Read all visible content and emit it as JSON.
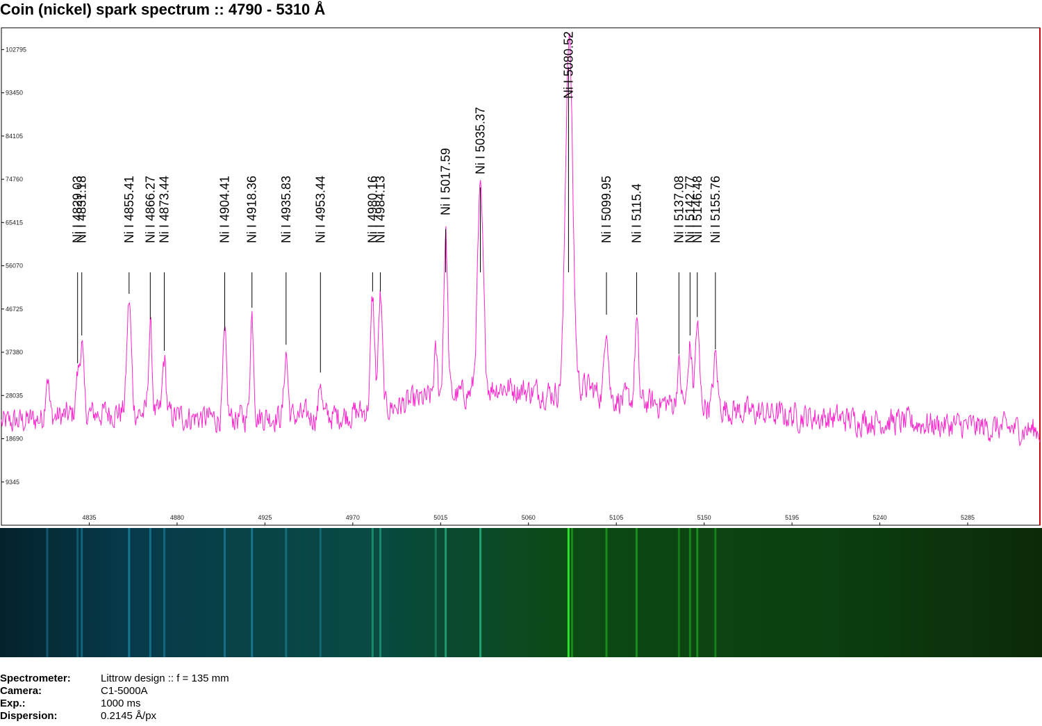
{
  "title": "Coin (nickel) spark spectrum :: 4790 - 5310 Å",
  "colors": {
    "spectrum": "#ff22cc",
    "frame": "#000000",
    "frame_right": "#cc0000",
    "strip_blue": "#063a4a",
    "strip_green": "#0c4a14"
  },
  "chart_data": {
    "type": "line",
    "title": "Coin (nickel) spark spectrum :: 4790 - 5310 Å",
    "xlabel": "",
    "ylabel": "",
    "xlim": [
      4790,
      5322
    ],
    "ylim": [
      0,
      107500
    ],
    "x_ticks": [
      4835,
      4880,
      4925,
      4970,
      5015,
      5060,
      5105,
      5150,
      5195,
      5240,
      5285
    ],
    "y_ticks": [
      9345,
      18690,
      28035,
      37380,
      46725,
      56070,
      65415,
      74760,
      84105,
      93450,
      102795
    ],
    "grid": false,
    "baseline": [
      [
        4790,
        22000
      ],
      [
        4820,
        23500
      ],
      [
        4850,
        24500
      ],
      [
        4880,
        23500
      ],
      [
        4900,
        23000
      ],
      [
        4930,
        23500
      ],
      [
        4960,
        23500
      ],
      [
        4990,
        25500
      ],
      [
        5010,
        27500
      ],
      [
        5030,
        28500
      ],
      [
        5045,
        30000
      ],
      [
        5060,
        29000
      ],
      [
        5075,
        28500
      ],
      [
        5090,
        30000
      ],
      [
        5100,
        27500
      ],
      [
        5120,
        26500
      ],
      [
        5150,
        26000
      ],
      [
        5170,
        24500
      ],
      [
        5200,
        23500
      ],
      [
        5240,
        22500
      ],
      [
        5280,
        21500
      ],
      [
        5322,
        20500
      ]
    ],
    "peaks": [
      {
        "x": 4813.5,
        "y": 33000,
        "w": 0.9
      },
      {
        "x": 4829.03,
        "y": 32000,
        "w": 0.9
      },
      {
        "x": 4831.18,
        "y": 39000,
        "w": 0.9
      },
      {
        "x": 4855.41,
        "y": 48500,
        "w": 1.1
      },
      {
        "x": 4866.27,
        "y": 43000,
        "w": 0.9
      },
      {
        "x": 4873.44,
        "y": 36000,
        "w": 0.9
      },
      {
        "x": 4904.41,
        "y": 40500,
        "w": 0.9
      },
      {
        "x": 4918.36,
        "y": 45500,
        "w": 0.9
      },
      {
        "x": 4935.83,
        "y": 37500,
        "w": 0.9
      },
      {
        "x": 4953.44,
        "y": 31500,
        "w": 0.8
      },
      {
        "x": 4980.16,
        "y": 49000,
        "w": 1.0
      },
      {
        "x": 4984.13,
        "y": 49500,
        "w": 1.0
      },
      {
        "x": 5012.5,
        "y": 37000,
        "w": 0.9
      },
      {
        "x": 5017.59,
        "y": 63000,
        "w": 1.0
      },
      {
        "x": 5035.37,
        "y": 71500,
        "w": 1.5
      },
      {
        "x": 5080.52,
        "y": 97000,
        "w": 1.7
      },
      {
        "x": 5082.3,
        "y": 45000,
        "w": 1.6
      },
      {
        "x": 5099.95,
        "y": 44000,
        "w": 1.0
      },
      {
        "x": 5115.4,
        "y": 44000,
        "w": 0.9
      },
      {
        "x": 5137.08,
        "y": 34500,
        "w": 0.9
      },
      {
        "x": 5142.77,
        "y": 39000,
        "w": 0.9
      },
      {
        "x": 5146.48,
        "y": 43500,
        "w": 1.0
      },
      {
        "x": 5155.76,
        "y": 36500,
        "w": 1.0
      }
    ],
    "annotations": [
      {
        "label": "Ni I 4829.03",
        "x": 4829.03,
        "line_bottom": 35000
      },
      {
        "label": "Ni I 4831.18",
        "x": 4831.18,
        "line_bottom": 41000
      },
      {
        "label": "Ni I 4855.41",
        "x": 4855.41,
        "line_bottom": 50000
      },
      {
        "label": "Ni I 4866.27",
        "x": 4866.27,
        "line_bottom": 44500
      },
      {
        "label": "Ni I 4873.44",
        "x": 4873.44,
        "line_bottom": 37700
      },
      {
        "label": "Ni I 4904.41",
        "x": 4904.41,
        "line_bottom": 42000
      },
      {
        "label": "Ni I 4918.36",
        "x": 4918.36,
        "line_bottom": 47000
      },
      {
        "label": "Ni I 4935.83",
        "x": 4935.83,
        "line_bottom": 39000
      },
      {
        "label": "Ni I 4953.44",
        "x": 4953.44,
        "line_bottom": 33000
      },
      {
        "label": "Ni I 4980.16",
        "x": 4980.16,
        "line_bottom": 50500
      },
      {
        "label": "Ni I 4984.13",
        "x": 4984.13,
        "line_bottom": 50500
      },
      {
        "label": "Ni I 5017.59",
        "x": 5017.59,
        "line_bottom": 64000
      },
      {
        "label": "Ni I 5035.37",
        "x": 5035.37,
        "line_bottom": 73000
      },
      {
        "label": "Ni I 5080.52",
        "x": 5080.52,
        "line_bottom": 99000
      },
      {
        "label": "Ni I 5099.95",
        "x": 5099.95,
        "line_bottom": 45500
      },
      {
        "label": "Ni I 5115.4",
        "x": 5115.4,
        "line_bottom": 45500
      },
      {
        "label": "Ni I 5137.08",
        "x": 5137.08,
        "line_bottom": 37000
      },
      {
        "label": "Ni I 5142.77",
        "x": 5142.77,
        "line_bottom": 41000
      },
      {
        "label": "Ni I 5146.48",
        "x": 5146.48,
        "line_bottom": 45000
      },
      {
        "label": "Ni I 5155.76",
        "x": 5155.76,
        "line_bottom": 38000
      }
    ],
    "noise_amplitude": 2500
  },
  "info": [
    {
      "key": "Spectrometer:",
      "value": "Littrow design :: f = 135 mm"
    },
    {
      "key": "Camera:",
      "value": "C1-5000A"
    },
    {
      "key": "Exp.:",
      "value": "1000 ms"
    },
    {
      "key": "Dispersion:",
      "value": "0.2145 Å/px"
    }
  ]
}
